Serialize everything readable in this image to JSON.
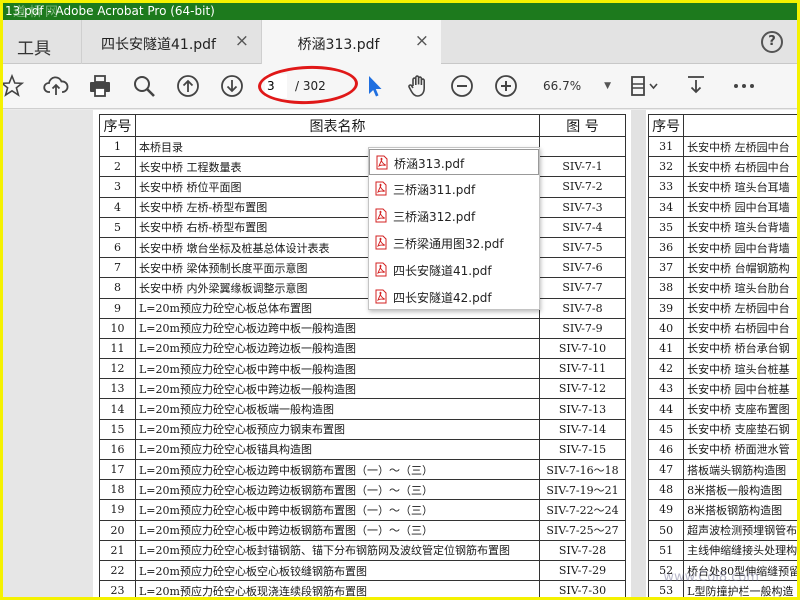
{
  "window": {
    "title": "13.pdf - Adobe Acrobat Pro (64-bit)",
    "watermark": "道桥网"
  },
  "tabs": {
    "tools": "工具",
    "items": [
      {
        "label": "四长安隧道41.pdf",
        "close": "×"
      },
      {
        "label": "桥涵313.pdf",
        "close": "×"
      }
    ],
    "help": "?"
  },
  "toolbar": {
    "page_current": "3",
    "page_total": "/ 302",
    "zoom": "66.7%",
    "icons": [
      "star-icon",
      "upload-icon",
      "print-icon",
      "zoom-search-icon",
      "page-up-icon",
      "page-down-icon",
      "select-cursor-icon",
      "hand-icon",
      "zoom-out-icon",
      "zoom-in-icon",
      "page-fit-icon",
      "download-icon",
      "more-icon"
    ]
  },
  "popup": {
    "items": [
      "桥涵313.pdf",
      "三桥涵311.pdf",
      "三桥涵312.pdf",
      "三桥梁通用图32.pdf",
      "四长安隧道41.pdf",
      "四长安隧道42.pdf"
    ]
  },
  "page1": {
    "headers": {
      "no": "序号",
      "name": "图表名称",
      "code": "图  号"
    },
    "rows": [
      {
        "no": "1",
        "name": "本桥目录",
        "code": ""
      },
      {
        "no": "2",
        "name": "长安中桥 工程数量表",
        "code": "SIV-7-1"
      },
      {
        "no": "3",
        "name": "长安中桥 桥位平面图",
        "code": "SIV-7-2"
      },
      {
        "no": "4",
        "name": "长安中桥 左桥-桥型布置图",
        "code": "SIV-7-3"
      },
      {
        "no": "5",
        "name": "长安中桥 右桥-桥型布置图",
        "code": "SIV-7-4"
      },
      {
        "no": "6",
        "name": "长安中桥 墩台坐标及桩基总体设计表表",
        "code": "SIV-7-5"
      },
      {
        "no": "7",
        "name": "长安中桥 梁体预制长度平面示意图",
        "code": "SIV-7-6"
      },
      {
        "no": "8",
        "name": "长安中桥 内外梁翼缘板调整示意图",
        "code": "SIV-7-7"
      },
      {
        "no": "9",
        "name": "L=20m预应力砼空心板总体布置图",
        "code": "SIV-7-8"
      },
      {
        "no": "10",
        "name": "L=20m预应力砼空心板边跨中板一般构造图",
        "code": "SIV-7-9"
      },
      {
        "no": "11",
        "name": "L=20m预应力砼空心板边跨边板一般构造图",
        "code": "SIV-7-10"
      },
      {
        "no": "12",
        "name": "L=20m预应力砼空心板中跨中板一般构造图",
        "code": "SIV-7-11"
      },
      {
        "no": "13",
        "name": "L=20m预应力砼空心板中跨边板一般构造图",
        "code": "SIV-7-12"
      },
      {
        "no": "14",
        "name": "L=20m预应力砼空心板板端一般构造图",
        "code": "SIV-7-13"
      },
      {
        "no": "15",
        "name": "L=20m预应力砼空心板预应力钢束布置图",
        "code": "SIV-7-14"
      },
      {
        "no": "16",
        "name": "L=20m预应力砼空心板锚具构造图",
        "code": "SIV-7-15"
      },
      {
        "no": "17",
        "name": "L=20m预应力砼空心板边跨中板钢筋布置图（一）～（三）",
        "code": "SIV-7-16～18"
      },
      {
        "no": "18",
        "name": "L=20m预应力砼空心板边跨边板钢筋布置图（一）～（三）",
        "code": "SIV-7-19～21"
      },
      {
        "no": "19",
        "name": "L=20m预应力砼空心板中跨中板钢筋布置图（一）～（三）",
        "code": "SIV-7-22～24"
      },
      {
        "no": "20",
        "name": "L=20m预应力砼空心板中跨边板钢筋布置图（一）～（三）",
        "code": "SIV-7-25～27"
      },
      {
        "no": "21",
        "name": "L=20m预应力砼空心板封锚钢筋、锚下分布钢筋网及波纹管定位钢筋布置图",
        "code": "SIV-7-28"
      },
      {
        "no": "22",
        "name": "L=20m预应力砼空心板空心板铰缝钢筋布置图",
        "code": "SIV-7-29"
      },
      {
        "no": "23",
        "name": "L=20m预应力砼空心板现浇连续段钢筋布置图",
        "code": "SIV-7-30"
      }
    ]
  },
  "page2": {
    "headers": {
      "no": "序号"
    },
    "rows": [
      {
        "no": "31",
        "name": "长安中桥 左桥园中台"
      },
      {
        "no": "32",
        "name": "长安中桥 右桥园中台"
      },
      {
        "no": "33",
        "name": "长安中桥 瑄头台耳墙"
      },
      {
        "no": "34",
        "name": "长安中桥 园中台耳墙"
      },
      {
        "no": "35",
        "name": "长安中桥 瑄头台背墙"
      },
      {
        "no": "36",
        "name": "长安中桥 园中台背墙"
      },
      {
        "no": "37",
        "name": "长安中桥 台帽钢筋构"
      },
      {
        "no": "38",
        "name": "长安中桥 瑄头台肋台"
      },
      {
        "no": "39",
        "name": "长安中桥 左桥园中台"
      },
      {
        "no": "40",
        "name": "长安中桥 右桥园中台"
      },
      {
        "no": "41",
        "name": "长安中桥 桥台承台钢"
      },
      {
        "no": "42",
        "name": "长安中桥 瑄头台桩基"
      },
      {
        "no": "43",
        "name": "长安中桥 园中台桩基"
      },
      {
        "no": "44",
        "name": "长安中桥 支座布置图"
      },
      {
        "no": "45",
        "name": "长安中桥 支座垫石钢"
      },
      {
        "no": "46",
        "name": "长安中桥 桥面泄水管"
      },
      {
        "no": "47",
        "name": "搭板端头钢筋构造图"
      },
      {
        "no": "48",
        "name": "8米搭板一般构造图"
      },
      {
        "no": "49",
        "name": "8米搭板钢筋构造图"
      },
      {
        "no": "50",
        "name": "超声波检测预埋钢管布"
      },
      {
        "no": "51",
        "name": "主线伸缩缝接头处理构"
      },
      {
        "no": "52",
        "name": "桥台处80型伸缩缝预留"
      },
      {
        "no": "53",
        "name": "L型防撞护栏一般构造"
      }
    ]
  },
  "footer_watermark": "www.Coi8.com"
}
